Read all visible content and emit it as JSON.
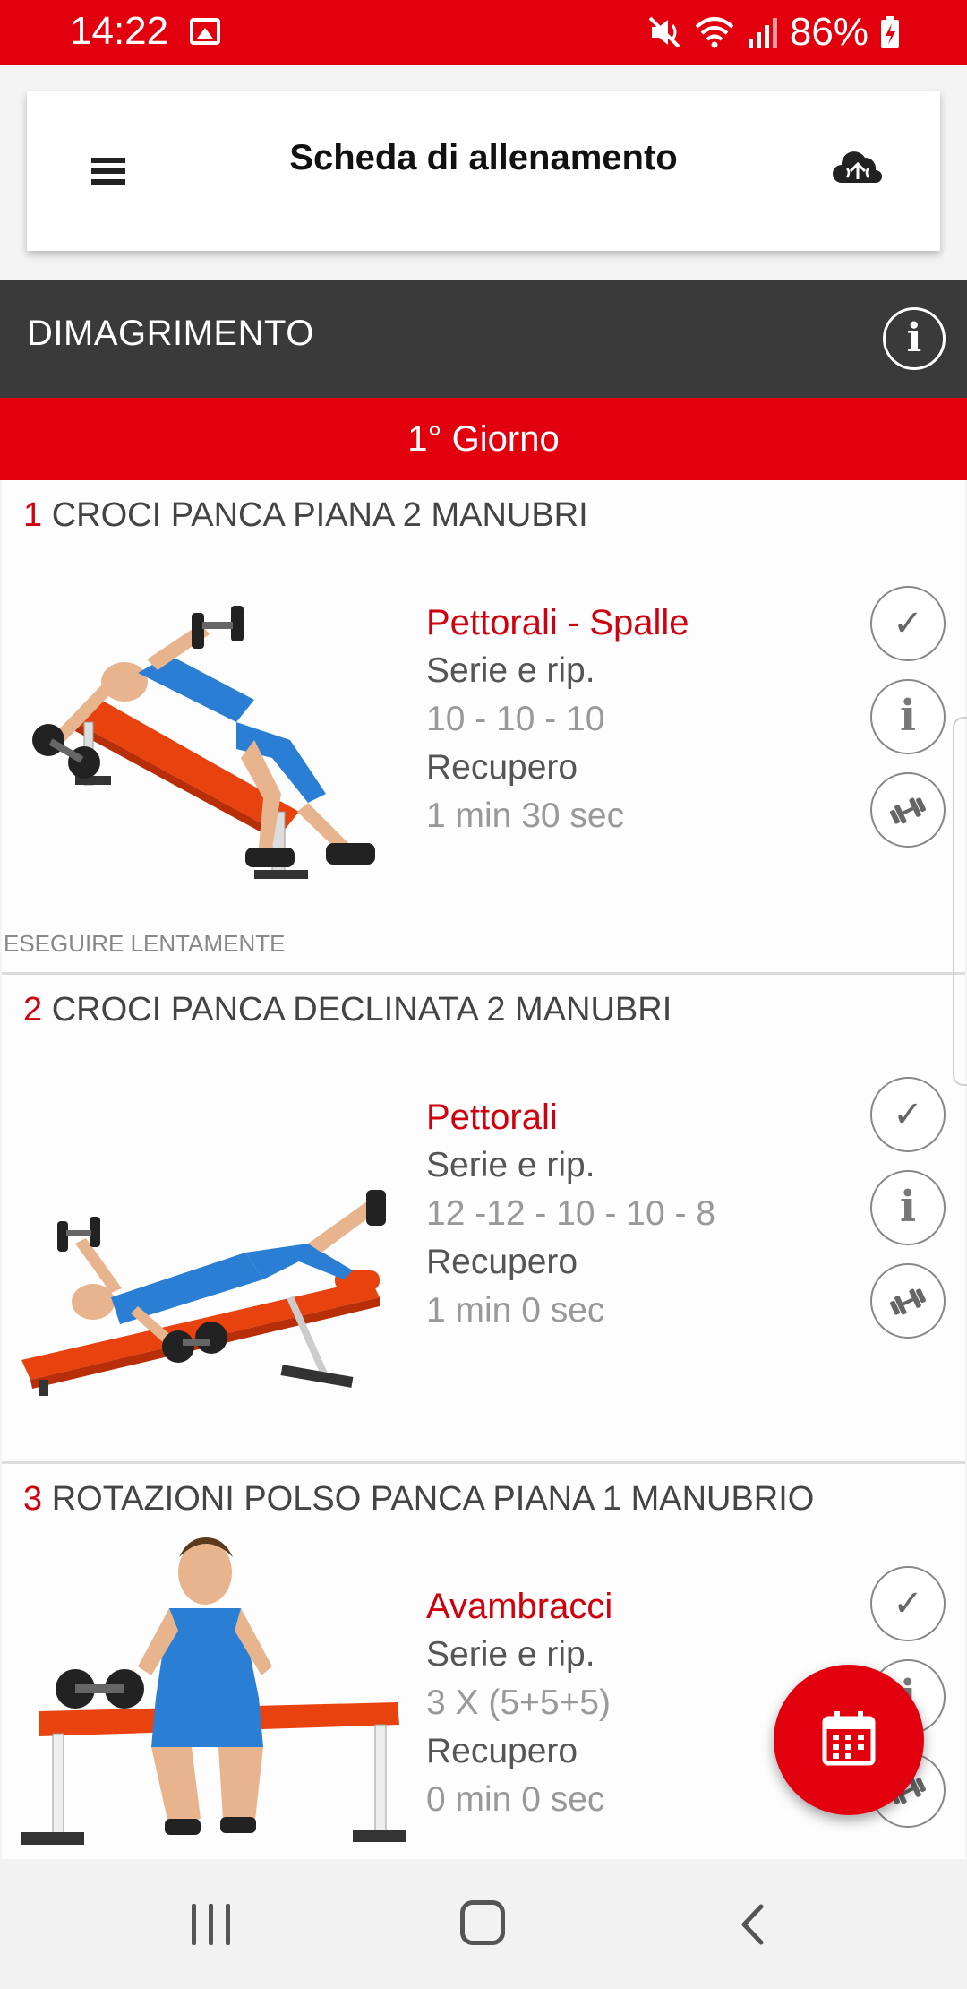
{
  "status_bar": {
    "time": "14:22",
    "battery": "86%",
    "icons": [
      "gallery-icon",
      "mute-icon",
      "wifi-icon",
      "signal-icon",
      "battery-charging-icon"
    ]
  },
  "app_bar": {
    "title": "Scheda di allenamento",
    "menu_icon": "hamburger-menu-icon",
    "action_icon": "cloud-sync-icon"
  },
  "plan": {
    "title": "DIMAGRIMENTO",
    "info_icon": "info-icon"
  },
  "day": {
    "label": "1° Giorno"
  },
  "labels": {
    "series": "Serie e rip.",
    "rest": "Recupero"
  },
  "exercises": [
    {
      "number": "1",
      "name": "CROCI PANCA PIANA 2 MANUBRI",
      "muscle": "Pettorali - Spalle",
      "series_label": "Serie e rip.",
      "series": "10 - 10 - 10",
      "rest_label": "Recupero",
      "rest": "1 min 30 sec",
      "note": "ESEGUIRE LENTAMENTE"
    },
    {
      "number": "2",
      "name": "CROCI PANCA DECLINATA 2 MANUBRI",
      "muscle": "Pettorali",
      "series_label": "Serie e rip.",
      "series": "12 -12 - 10 - 10 - 8",
      "rest_label": "Recupero",
      "rest": "1 min 0 sec",
      "note": ""
    },
    {
      "number": "3",
      "name": "ROTAZIONI POLSO PANCA PIANA 1 MANUBRIO",
      "muscle": "Avambracci",
      "series_label": "Serie e rip.",
      "series": "3 X (5+5+5)",
      "rest_label": "Recupero",
      "rest": "0 min 0 sec",
      "note": ""
    }
  ],
  "fab": {
    "icon": "calendar-icon"
  },
  "colors": {
    "accent": "#e2000f",
    "plan_bar": "#3a3a3a",
    "muscle_text": "#d0000d",
    "value_text": "#999999"
  }
}
